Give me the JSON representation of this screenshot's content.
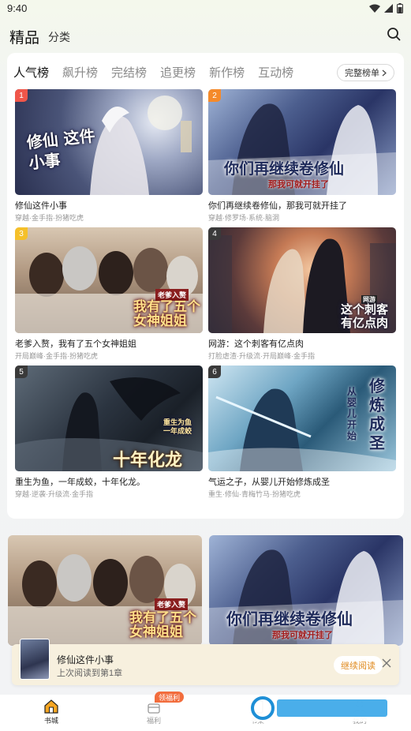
{
  "status": {
    "time": "9:40"
  },
  "header": {
    "title": "精品",
    "secondary_tab": "分类"
  },
  "ranking": {
    "tabs": [
      "人气榜",
      "飙升榜",
      "完结榜",
      "追更榜",
      "新作榜",
      "互动榜"
    ],
    "full_list_label": "完整榜单",
    "books": [
      {
        "rank": "1",
        "title": "修仙这件小事",
        "tags": "穿越·金手指·扮猪吃虎",
        "cover_text": "修仙 这件小事"
      },
      {
        "rank": "2",
        "title": "你们再继续卷修仙，那我可就开挂了",
        "tags": "穿越·修罗场·系统·脑洞",
        "cover_text": "你们再继续卷修仙",
        "cover_sub": "那我可就开挂了"
      },
      {
        "rank": "3",
        "title": "老爹入赘，我有了五个女神姐姐",
        "tags": "开局巅峰·金手指·扮猪吃虎",
        "cover_text": "我有了五个 女神姐姐",
        "cover_sub": "老爹入赘"
      },
      {
        "rank": "4",
        "title": "网游：这个刺客有亿点肉",
        "tags": "打脸虐渣·升级流·开局巅峰·金手指",
        "cover_text": "这个刺客 有亿点肉",
        "cover_sub": "网游"
      },
      {
        "rank": "5",
        "title": "重生为鱼，一年成蛟，十年化龙。",
        "tags": "穿越·逆袭·升级流·金手指",
        "cover_text": "十年化龙",
        "cover_sub": "重生为鱼 一年成蛟"
      },
      {
        "rank": "6",
        "title": "气运之子，从婴儿开始修炼成圣",
        "tags": "重生·修仙·青梅竹马·扮猪吃虎",
        "cover_text": "修炼成圣",
        "cover_sub": "从婴儿开始"
      }
    ]
  },
  "lower": {
    "covers": [
      {
        "cover_text": "我有了五个 女神姐姐",
        "cover_sub": "老爹入赘"
      },
      {
        "cover_text": "你们再继续卷修仙",
        "cover_sub": "那我可就开挂了"
      }
    ]
  },
  "continue_reading": {
    "title": "修仙这件小事",
    "subtitle": "上次阅读到第1章",
    "button": "继续阅读"
  },
  "bottom_nav": {
    "items": [
      "书城",
      "福利",
      "书架",
      "我的"
    ],
    "welfare_badge": "领福利"
  },
  "colors": {
    "accent": "#f5a623",
    "rank1": "#f0564a",
    "rank2": "#f58a2a",
    "rank3": "#f5c02a",
    "rank_other": "#3a3a3a"
  }
}
